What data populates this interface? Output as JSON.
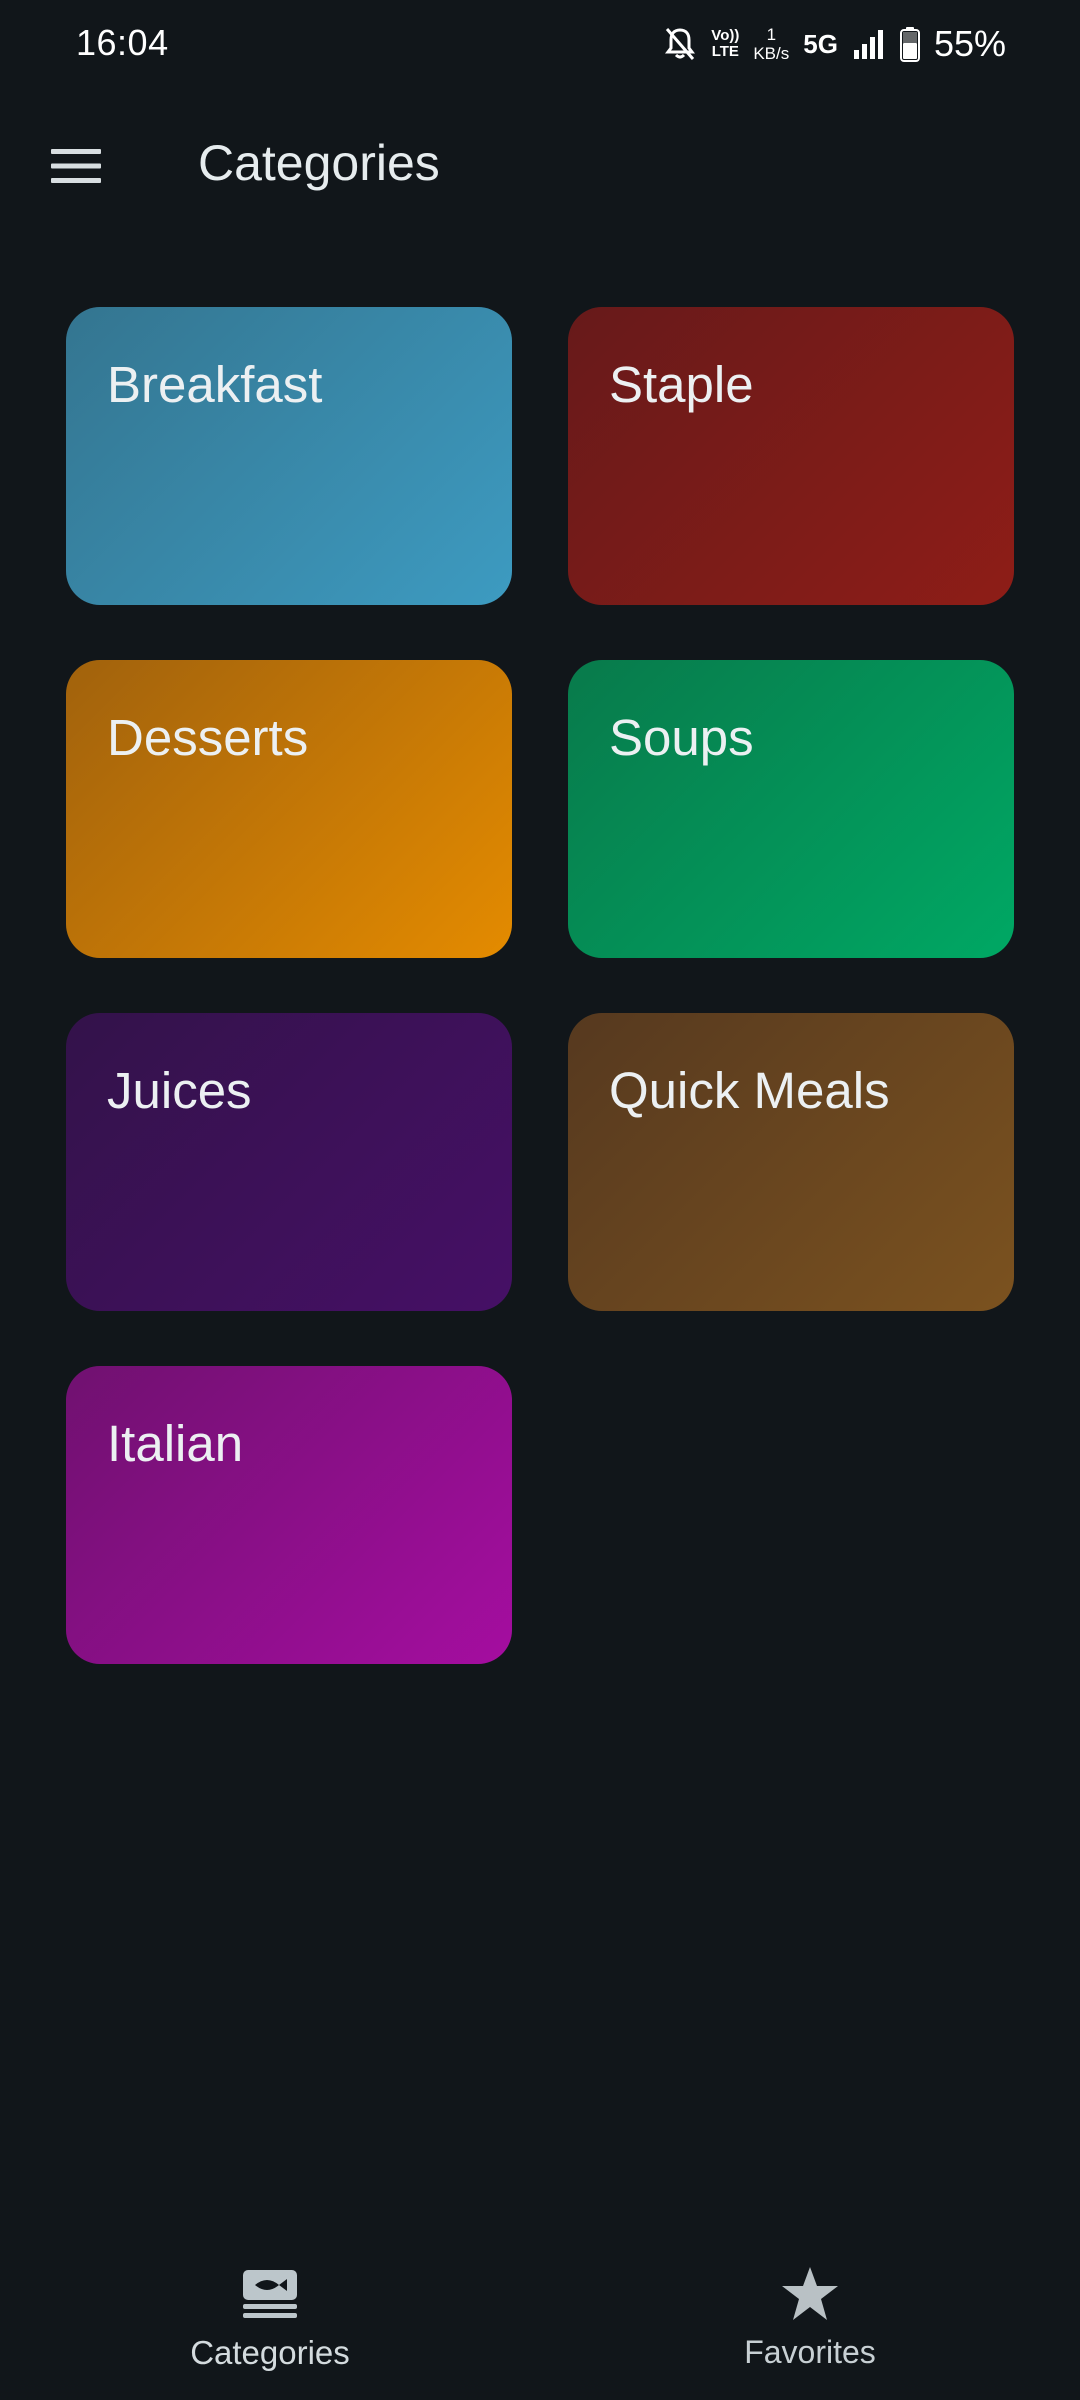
{
  "status_bar": {
    "time": "16:04",
    "volte_top": "Vo))",
    "volte_bottom": "LTE",
    "netspeed_value": "1",
    "netspeed_unit": "KB/s",
    "network": "5G",
    "battery": "55%",
    "icons": [
      "mute-bell-icon",
      "signal-icon",
      "battery-icon"
    ]
  },
  "app_bar": {
    "menu_icon": "hamburger-menu-icon",
    "title": "Categories"
  },
  "categories": [
    {
      "label": "Breakfast",
      "color_from": "#347590",
      "color_to": "#3d9bc1"
    },
    {
      "label": "Staple",
      "color_from": "#671a1a",
      "color_to": "#8e1d17"
    },
    {
      "label": "Desserts",
      "color_from": "#a1620d",
      "color_to": "#e48b00"
    },
    {
      "label": "Soups",
      "color_from": "#087a4b",
      "color_to": "#00a864"
    },
    {
      "label": "Juices",
      "color_from": "#33124a",
      "color_to": "#461066"
    },
    {
      "label": "Quick Meals",
      "color_from": "#56391f",
      "color_to": "#7b521f"
    },
    {
      "label": "Italian",
      "color_from": "#701170",
      "color_to": "#a50da0"
    }
  ],
  "bottom_nav": {
    "items": [
      {
        "label": "Categories",
        "icon": "category-icon",
        "active": true
      },
      {
        "label": "Favorites",
        "icon": "star-icon",
        "active": false
      }
    ]
  },
  "colors": {
    "background": "#11161a",
    "text": "#e6ecee",
    "nav_icon": "#b9c4c9"
  }
}
